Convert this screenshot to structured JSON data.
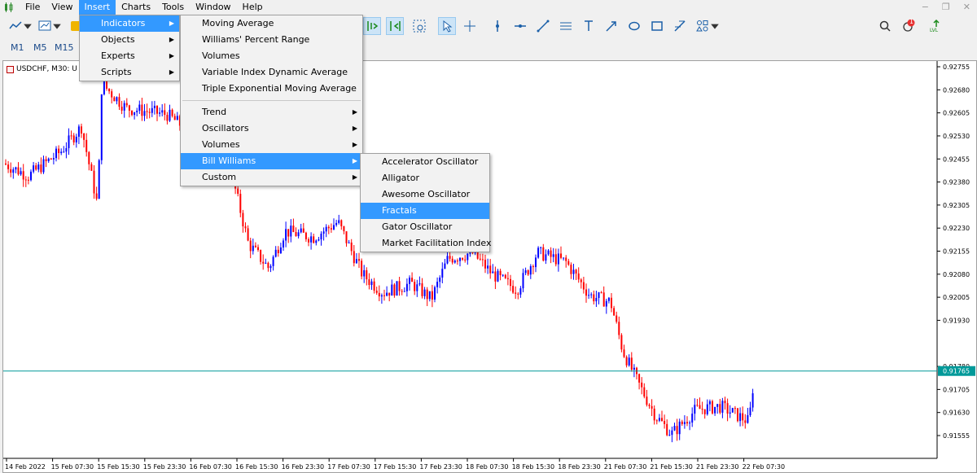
{
  "menubar": {
    "items": [
      "File",
      "View",
      "Insert",
      "Charts",
      "Tools",
      "Window",
      "Help"
    ],
    "active_index": 2
  },
  "toolbar": {
    "icons": [
      "line-chart-icon",
      "dropdown-arrow-icon",
      "profiles-icon",
      "dropdown-arrow-icon",
      "template-icon",
      "scroll-chart-icon",
      "autoscroll-icon",
      "screenshot-icon",
      "cursor-icon",
      "crosshair-icon",
      "vertical-line-icon",
      "horizontal-line-icon",
      "trendline-icon",
      "channel-icon",
      "text-icon",
      "shapes-icon",
      "rectangle-icon",
      "arrow-icon",
      "objects-icon",
      "dropdown-arrow-icon",
      "search-icon",
      "notifications-icon",
      "signal-icon"
    ],
    "notification_count": "1",
    "signal_label": "LVL"
  },
  "timeframes": [
    "M1",
    "M5",
    "M15"
  ],
  "chart": {
    "symbol": "USDCHF, M30:  U",
    "price_labels": [
      "0.92755",
      "0.92680",
      "0.92605",
      "0.92530",
      "0.92455",
      "0.92380",
      "0.92305",
      "0.92230",
      "0.92155",
      "0.92080",
      "0.92005",
      "0.91930",
      "0.91780",
      "0.91705",
      "0.91630",
      "0.91555"
    ],
    "current_price": "0.91765",
    "time_labels": [
      "14 Feb 2022",
      "15 Feb 07:30",
      "15 Feb 15:30",
      "15 Feb 23:30",
      "16 Feb 07:30",
      "16 Feb 15:30",
      "16 Feb 23:30",
      "17 Feb 07:30",
      "17 Feb 15:30",
      "17 Feb 23:30",
      "18 Feb 07:30",
      "18 Feb 15:30",
      "18 Feb 23:30",
      "21 Feb 07:30",
      "21 Feb 15:30",
      "21 Feb 23:30",
      "22 Feb 07:30"
    ],
    "bull_color": "#0000ff",
    "bear_color": "#ff0000",
    "bid_line_color": "#009999"
  },
  "insert_menu": {
    "items": [
      "Indicators",
      "Objects",
      "Experts",
      "Scripts"
    ]
  },
  "indicators_menu": {
    "items_top": [
      "Moving Average",
      "Williams' Percent Range",
      "Volumes",
      "Variable Index Dynamic Average",
      "Triple Exponential Moving Average"
    ],
    "items_bottom": [
      "Trend",
      "Oscillators",
      "Volumes",
      "Bill Williams",
      "Custom"
    ]
  },
  "bill_williams_menu": {
    "items": [
      "Accelerator Oscillator",
      "Alligator",
      "Awesome Oscillator",
      "Fractals",
      "Gator Oscillator",
      "Market Facilitation Index"
    ]
  }
}
